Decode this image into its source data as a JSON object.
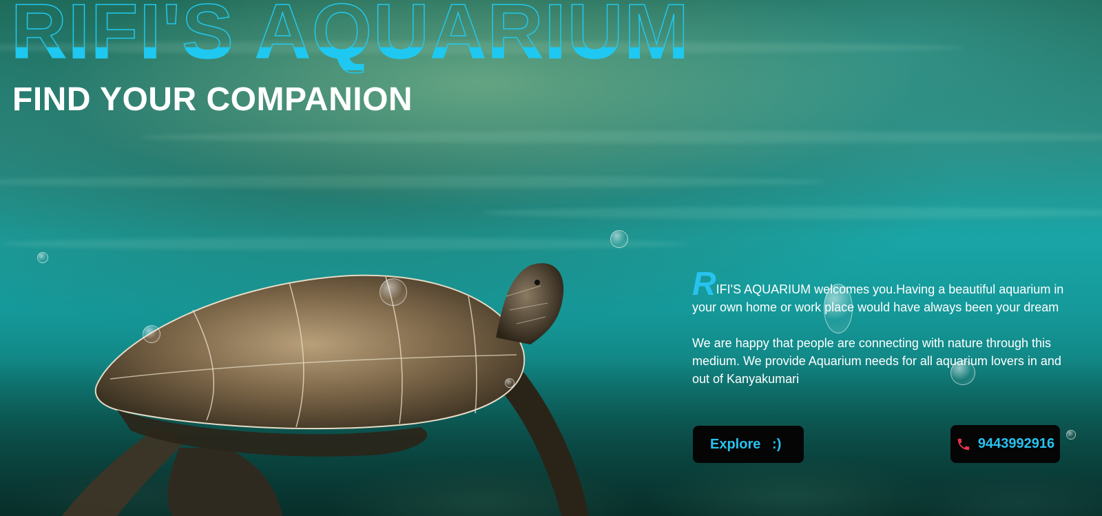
{
  "site": {
    "title": "RIFI'S AQUARIUM",
    "tagline": "FIND YOUR COMPANION"
  },
  "intro": {
    "dropcap": "R",
    "paragraph1_rest": "IFI'S AQUARIUM welcomes you.Having a beautiful aquarium in your own home or work place would have always been your dream",
    "paragraph2": "We are happy that people are connecting with nature through this medium. We provide Aquarium needs for all aquarium lovers in and out of Kanyakumari"
  },
  "actions": {
    "explore_label": "Explore   :)",
    "phone_number": "9443992916",
    "phone_icon": "phone-icon"
  },
  "colors": {
    "accent": "#27c3f0",
    "button_bg": "#050505",
    "phone_icon": "#e8334a",
    "text": "#ffffff"
  },
  "background": {
    "description_icon": "underwater-turtle-photo"
  }
}
